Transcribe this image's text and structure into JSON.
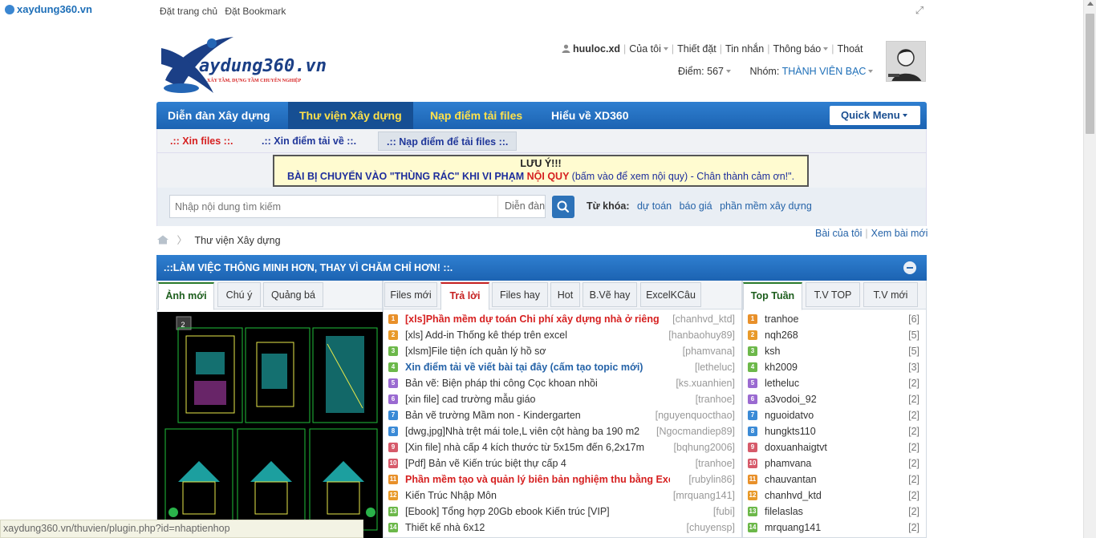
{
  "browser": {
    "site_name": "xaydung360.vn",
    "top_links": [
      "Đặt trang chủ",
      "Đặt Bookmark"
    ],
    "status_url": "xaydung360.vn/thuvien/plugin.php?id=nhaptienhop"
  },
  "logo": {
    "word": "aydung360.vn",
    "slogan": "XÂY TẦM, DỰNG TẦM CHUYÊN NGHIỆP"
  },
  "user": {
    "name": "huuloc.xd",
    "menu": [
      "Của tôi",
      "Thiết đặt",
      "Tin nhắn",
      "Thông báo",
      "Thoát"
    ],
    "points_label": "Điểm:",
    "points_value": "567",
    "group_label": "Nhóm:",
    "group_value": "THÀNH VIÊN BẠC"
  },
  "nav": {
    "tabs": [
      "Diễn đàn Xây dựng",
      "Thư viện Xây dựng",
      "Nạp điểm tải files",
      "Hiểu về XD360"
    ],
    "quick_menu": "Quick Menu"
  },
  "subnav": [
    ".:: Xin files ::.",
    ".:: Xin điểm tải về ::.",
    ".:: Nạp điểm để tải files ::."
  ],
  "notice": {
    "line1": "LƯU Ý!!!",
    "line2_a": "BÀI BỊ CHUYỂN VÀO \"THÙNG RÁC\" KHI VI PHẠM",
    "line2_b": "NỘI QUY",
    "line2_c": "(bấm vào để xem nội quy)",
    "line2_d": "- Chân thành cảm ơn!\"."
  },
  "search": {
    "placeholder": "Nhập nội dung tìm kiếm",
    "scope": "Diễn đàn",
    "keywords_label": "Từ khóa:",
    "keywords": [
      "dự toán",
      "báo giá",
      "phần mềm xây dựng"
    ]
  },
  "breadcrumb": {
    "current": "Thư viện Xây dựng",
    "right_links": [
      "Bài của tôi",
      "Xem bài mới"
    ]
  },
  "block_title": ".::LÀM VIỆC THÔNG MINH HƠN, THAY VÌ CHĂM CHỈ HƠN! ::.",
  "left_panel": {
    "tabs": [
      "Ảnh mới",
      "Chú ý",
      "Quảng bá"
    ],
    "image_counter": "2"
  },
  "mid_panel": {
    "tabs": [
      "Files mới",
      "Trả lời",
      "Files hay",
      "Hot",
      "B.Vẽ hay",
      "ExcelKCâu"
    ],
    "rows": [
      {
        "icon": "1",
        "color": "#e8902a",
        "title": "[xls]Phần mềm dự toán Chi phí xây dựng nhà ở riêng",
        "author": "[chanhvd_ktd]",
        "style": "hot"
      },
      {
        "icon": "2",
        "color": "#e89a2a",
        "title": "[xls] Add-in Thống kê thép trên excel",
        "author": "[hanbaohuy89]",
        "style": ""
      },
      {
        "icon": "3",
        "color": "#6cb84a",
        "title": "[xlsm]File tiện ích quản lý hồ sơ",
        "author": "[phamvana]",
        "style": ""
      },
      {
        "icon": "4",
        "color": "#6cb84a",
        "title": "Xin điểm tải về viết bài tại đây (cấm tạo topic mới)",
        "author": "[letheluc]",
        "style": "bluebold"
      },
      {
        "icon": "5",
        "color": "#9a6ad1",
        "title": "Bản vẽ: Biện pháp thi công Cọc khoan nhồi",
        "author": "[ks.xuanhien]",
        "style": ""
      },
      {
        "icon": "6",
        "color": "#9a6ad1",
        "title": "[xin file] cad trường mẫu giáo",
        "author": "[tranhoe]",
        "style": ""
      },
      {
        "icon": "7",
        "color": "#3a8ad6",
        "title": "Bản vẽ trường Mầm non - Kindergarten",
        "author": "[nguyenquocthao]",
        "style": ""
      },
      {
        "icon": "8",
        "color": "#3a8ad6",
        "title": "[dwg,jpg]Nhà trệt mái tole,L viên cột hàng ba 190 m2",
        "author": "[Ngocmandiep89]",
        "style": ""
      },
      {
        "icon": "9",
        "color": "#d65a6a",
        "title": "[Xin file] nhà cấp 4 kích thước từ 5x15m đến 6,2x17m",
        "author": "[bqhung2006]",
        "style": ""
      },
      {
        "icon": "10",
        "color": "#d65a6a",
        "title": "[Pdf] Bản vẽ Kiến trúc biệt thự cấp 4",
        "author": "[tranhoe]",
        "style": ""
      },
      {
        "icon": "11",
        "color": "#e8902a",
        "title": "Phần mềm tạo và quản lý biên bản nghiệm thu bằng Exc",
        "author": "[rubylin86]",
        "style": "hot"
      },
      {
        "icon": "12",
        "color": "#e89a2a",
        "title": "Kiến Trúc Nhập Môn",
        "author": "[mrquang141]",
        "style": ""
      },
      {
        "icon": "13",
        "color": "#6cb84a",
        "title": "[Ebook] Tổng hợp 20Gb ebook Kiến trúc [VIP]",
        "author": "[fubi]",
        "style": ""
      },
      {
        "icon": "14",
        "color": "#6cb84a",
        "title": "Thiết kế nhà 6x12",
        "author": "[chuyensp]",
        "style": ""
      }
    ]
  },
  "right_panel": {
    "tabs": [
      "Top Tuần",
      "T.V TOP",
      "T.V mới"
    ],
    "rows": [
      {
        "icon": "1",
        "color": "#e8902a",
        "name": "tranhoe",
        "count": "[6]"
      },
      {
        "icon": "2",
        "color": "#e89a2a",
        "name": "nqh268",
        "count": "[5]"
      },
      {
        "icon": "3",
        "color": "#6cb84a",
        "name": "ksh",
        "count": "[5]"
      },
      {
        "icon": "4",
        "color": "#6cb84a",
        "name": "kh2009",
        "count": "[3]"
      },
      {
        "icon": "5",
        "color": "#9a6ad1",
        "name": "letheluc",
        "count": "[2]"
      },
      {
        "icon": "6",
        "color": "#9a6ad1",
        "name": "a3vodoi_92",
        "count": "[2]"
      },
      {
        "icon": "7",
        "color": "#3a8ad6",
        "name": "nguoidatvo",
        "count": "[2]"
      },
      {
        "icon": "8",
        "color": "#3a8ad6",
        "name": "hungkts110",
        "count": "[2]"
      },
      {
        "icon": "9",
        "color": "#d65a6a",
        "name": "doxuanhaigtvt",
        "count": "[2]"
      },
      {
        "icon": "10",
        "color": "#d65a6a",
        "name": "phamvana",
        "count": "[2]"
      },
      {
        "icon": "11",
        "color": "#e8902a",
        "name": "chauvantan",
        "count": "[2]"
      },
      {
        "icon": "12",
        "color": "#e89a2a",
        "name": "chanhvd_ktd",
        "count": "[2]"
      },
      {
        "icon": "13",
        "color": "#6cb84a",
        "name": "filelaslas",
        "count": "[2]"
      },
      {
        "icon": "14",
        "color": "#6cb84a",
        "name": "mrquang141",
        "count": "[2]"
      }
    ]
  }
}
